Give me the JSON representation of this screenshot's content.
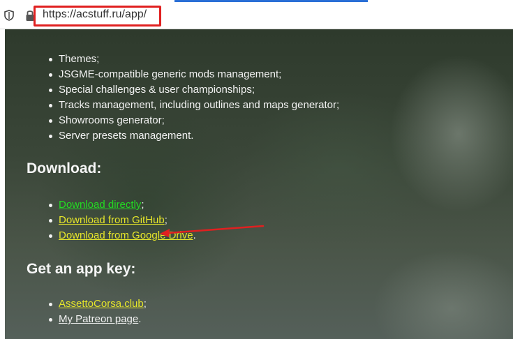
{
  "browser": {
    "url": "https://acstuff.ru/app/",
    "highlight_color": "#e02020"
  },
  "icons": {
    "tracking": "shield-icon",
    "security": "lock-icon"
  },
  "features": [
    "Themes;",
    "JSGME-compatible generic mods management;",
    "Special challenges & user championships;",
    "Tracks management, including outlines and maps generator;",
    "Showrooms generator;",
    "Server presets management."
  ],
  "download_section": {
    "title": "Download:",
    "links": [
      {
        "label": "Download directly",
        "suffix": ";"
      },
      {
        "label": "Download from GitHub",
        "suffix": ";"
      },
      {
        "label": "Download from Google Drive",
        "suffix": "."
      }
    ]
  },
  "key_section": {
    "title": "Get an app key:",
    "links": [
      {
        "label": "AssettoCorsa.club",
        "suffix": ";"
      },
      {
        "label": "My Patreon page",
        "suffix": "."
      }
    ]
  },
  "colors": {
    "link_primary": "#22dd22",
    "link_secondary": "#e6e62a",
    "annotation_arrow": "#e02020"
  }
}
